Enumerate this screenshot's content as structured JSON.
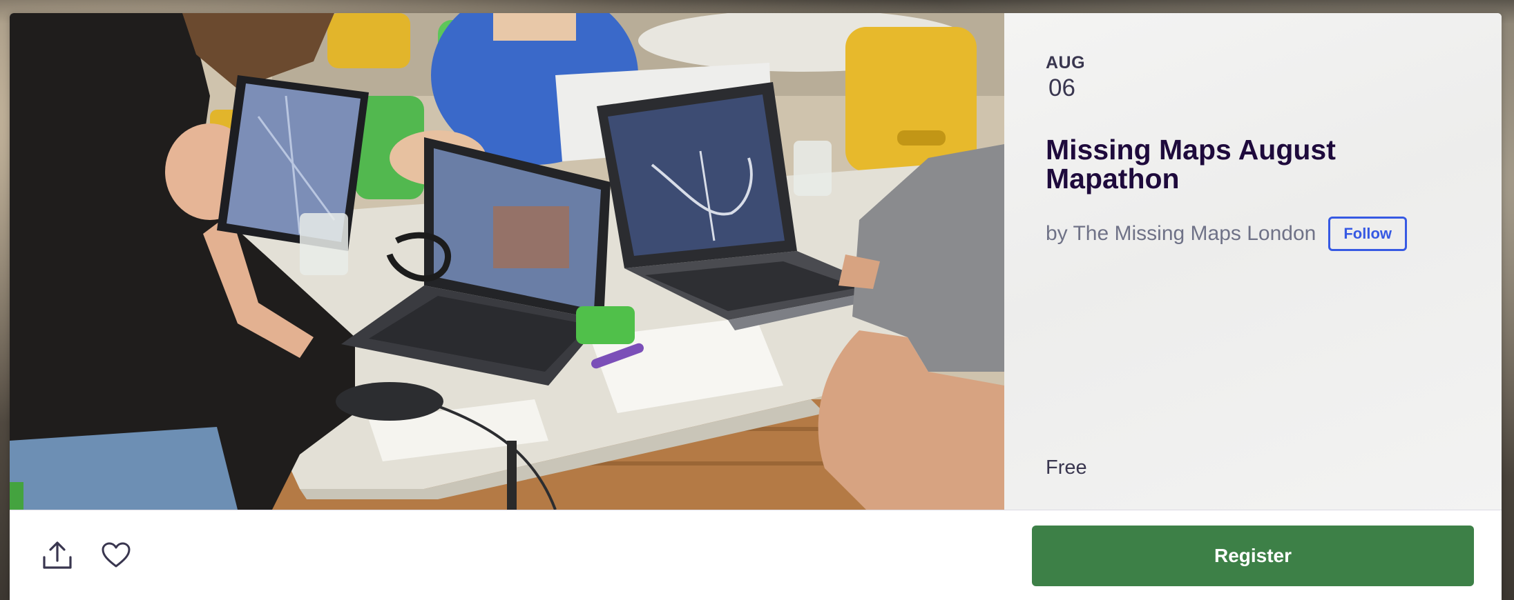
{
  "event": {
    "date_month": "AUG",
    "date_day": "06",
    "title": "Missing Maps August Mapathon",
    "organizer_text": "by The Missing Maps London",
    "follow_label": "Follow",
    "price": "Free"
  },
  "actions": {
    "share_icon": "share-upload-icon",
    "like_icon": "heart-outline-icon",
    "register_label": "Register"
  },
  "colors": {
    "title": "#1e0a3c",
    "follow_accent": "#3659e3",
    "register_bg": "#3d8047"
  }
}
